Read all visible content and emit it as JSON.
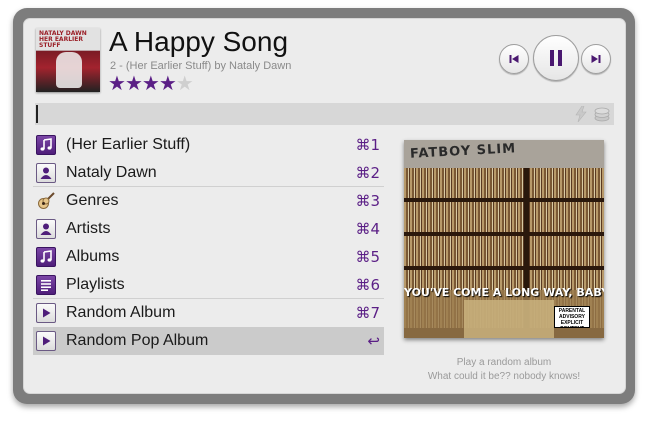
{
  "now_playing": {
    "title": "A Happy Song",
    "subtitle": "2 - (Her Earlier Stuff) by Nataly Dawn",
    "rating": 4,
    "rating_max": 5,
    "small_cover_text": "NATALY DAWN\nHER EARLIER\nSTUFF"
  },
  "controls": {
    "previous_icon": "skip-previous-icon",
    "pause_icon": "pause-icon",
    "next_icon": "skip-next-icon"
  },
  "search": {
    "value": "",
    "right_icons": [
      "lightning-bolt-icon",
      "stack-icon"
    ]
  },
  "menu": {
    "items": [
      {
        "label": "(Her Earlier Stuff)",
        "shortcut": "⌘1",
        "icon": "album-note-icon"
      },
      {
        "label": "Nataly Dawn",
        "shortcut": "⌘2",
        "icon": "artist-icon"
      },
      {
        "label": "Genres",
        "shortcut": "⌘3",
        "icon": "guitar-icon"
      },
      {
        "label": "Artists",
        "shortcut": "⌘4",
        "icon": "artist-icon"
      },
      {
        "label": "Albums",
        "shortcut": "⌘5",
        "icon": "album-note-icon"
      },
      {
        "label": "Playlists",
        "shortcut": "⌘6",
        "icon": "playlist-icon"
      },
      {
        "label": "Random Album",
        "shortcut": "⌘7",
        "icon": "play-icon"
      },
      {
        "label": "Random Pop Album",
        "shortcut": "↩",
        "icon": "play-icon"
      }
    ],
    "selected_index": 7
  },
  "preview": {
    "album_text": "YOU'VE COME A LONG WAY, BABY",
    "logo_text": "FATBOY SLIM",
    "advisory_text": "PARENTAL ADVISORY EXPLICIT CONTENT",
    "caption_line1": "Play a random album",
    "caption_line2": "What could it be?? nobody knows!"
  },
  "colors": {
    "accent": "#5b1f86",
    "panel": "#ececec",
    "frame": "#7d7d7d",
    "selected_row": "#cbcbcb"
  }
}
